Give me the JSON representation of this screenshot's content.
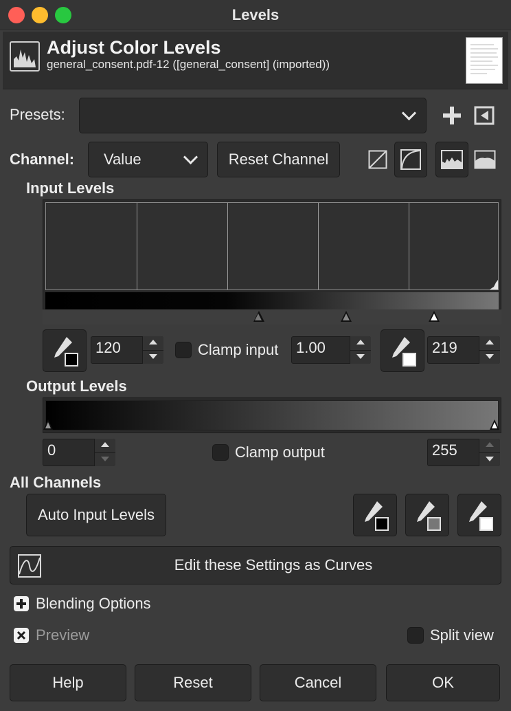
{
  "window": {
    "title": "Levels"
  },
  "header": {
    "title": "Adjust Color Levels",
    "subtitle": "general_consent.pdf-12 ([general_consent] (imported))"
  },
  "presets": {
    "label": "Presets:",
    "value": ""
  },
  "channel": {
    "label": "Channel:",
    "value": "Value",
    "reset_label": "Reset Channel"
  },
  "input_levels": {
    "label": "Input Levels",
    "low": "120",
    "gamma": "1.00",
    "high": "219",
    "clamp_label": "Clamp input",
    "clamp_checked": false
  },
  "output_levels": {
    "label": "Output Levels",
    "low": "0",
    "high": "255",
    "clamp_label": "Clamp output",
    "clamp_checked": false
  },
  "all_channels": {
    "label": "All Channels",
    "auto_label": "Auto Input Levels"
  },
  "curves_button": {
    "label": "Edit these Settings as Curves"
  },
  "blending": {
    "label": "Blending Options"
  },
  "preview": {
    "label": "Preview",
    "checked": true
  },
  "split_view": {
    "label": "Split view",
    "checked": false
  },
  "buttons": {
    "help": "Help",
    "reset": "Reset",
    "cancel": "Cancel",
    "ok": "OK"
  },
  "colors": {
    "close": "#ff5f57",
    "minimize": "#febc2e",
    "zoom": "#28c840"
  }
}
